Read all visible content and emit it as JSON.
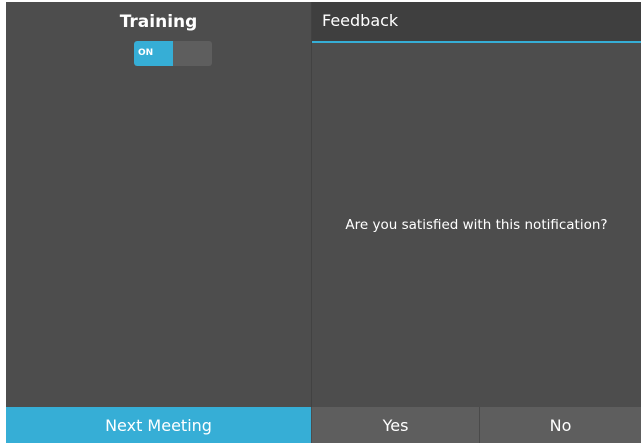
{
  "training": {
    "title": "Training",
    "toggle_label": "ON",
    "toggle_state": "on"
  },
  "feedback": {
    "title": "Feedback",
    "question": "Are you satisfied with this notification?"
  },
  "bottom_bar": {
    "next_meeting_label": "Next Meeting",
    "yes_label": "Yes",
    "no_label": "No"
  },
  "colors": {
    "accent": "#36aed6",
    "panel_background": "#4d4d4d",
    "header_background": "#3f3f3f",
    "button_background": "#5e5e5e"
  }
}
